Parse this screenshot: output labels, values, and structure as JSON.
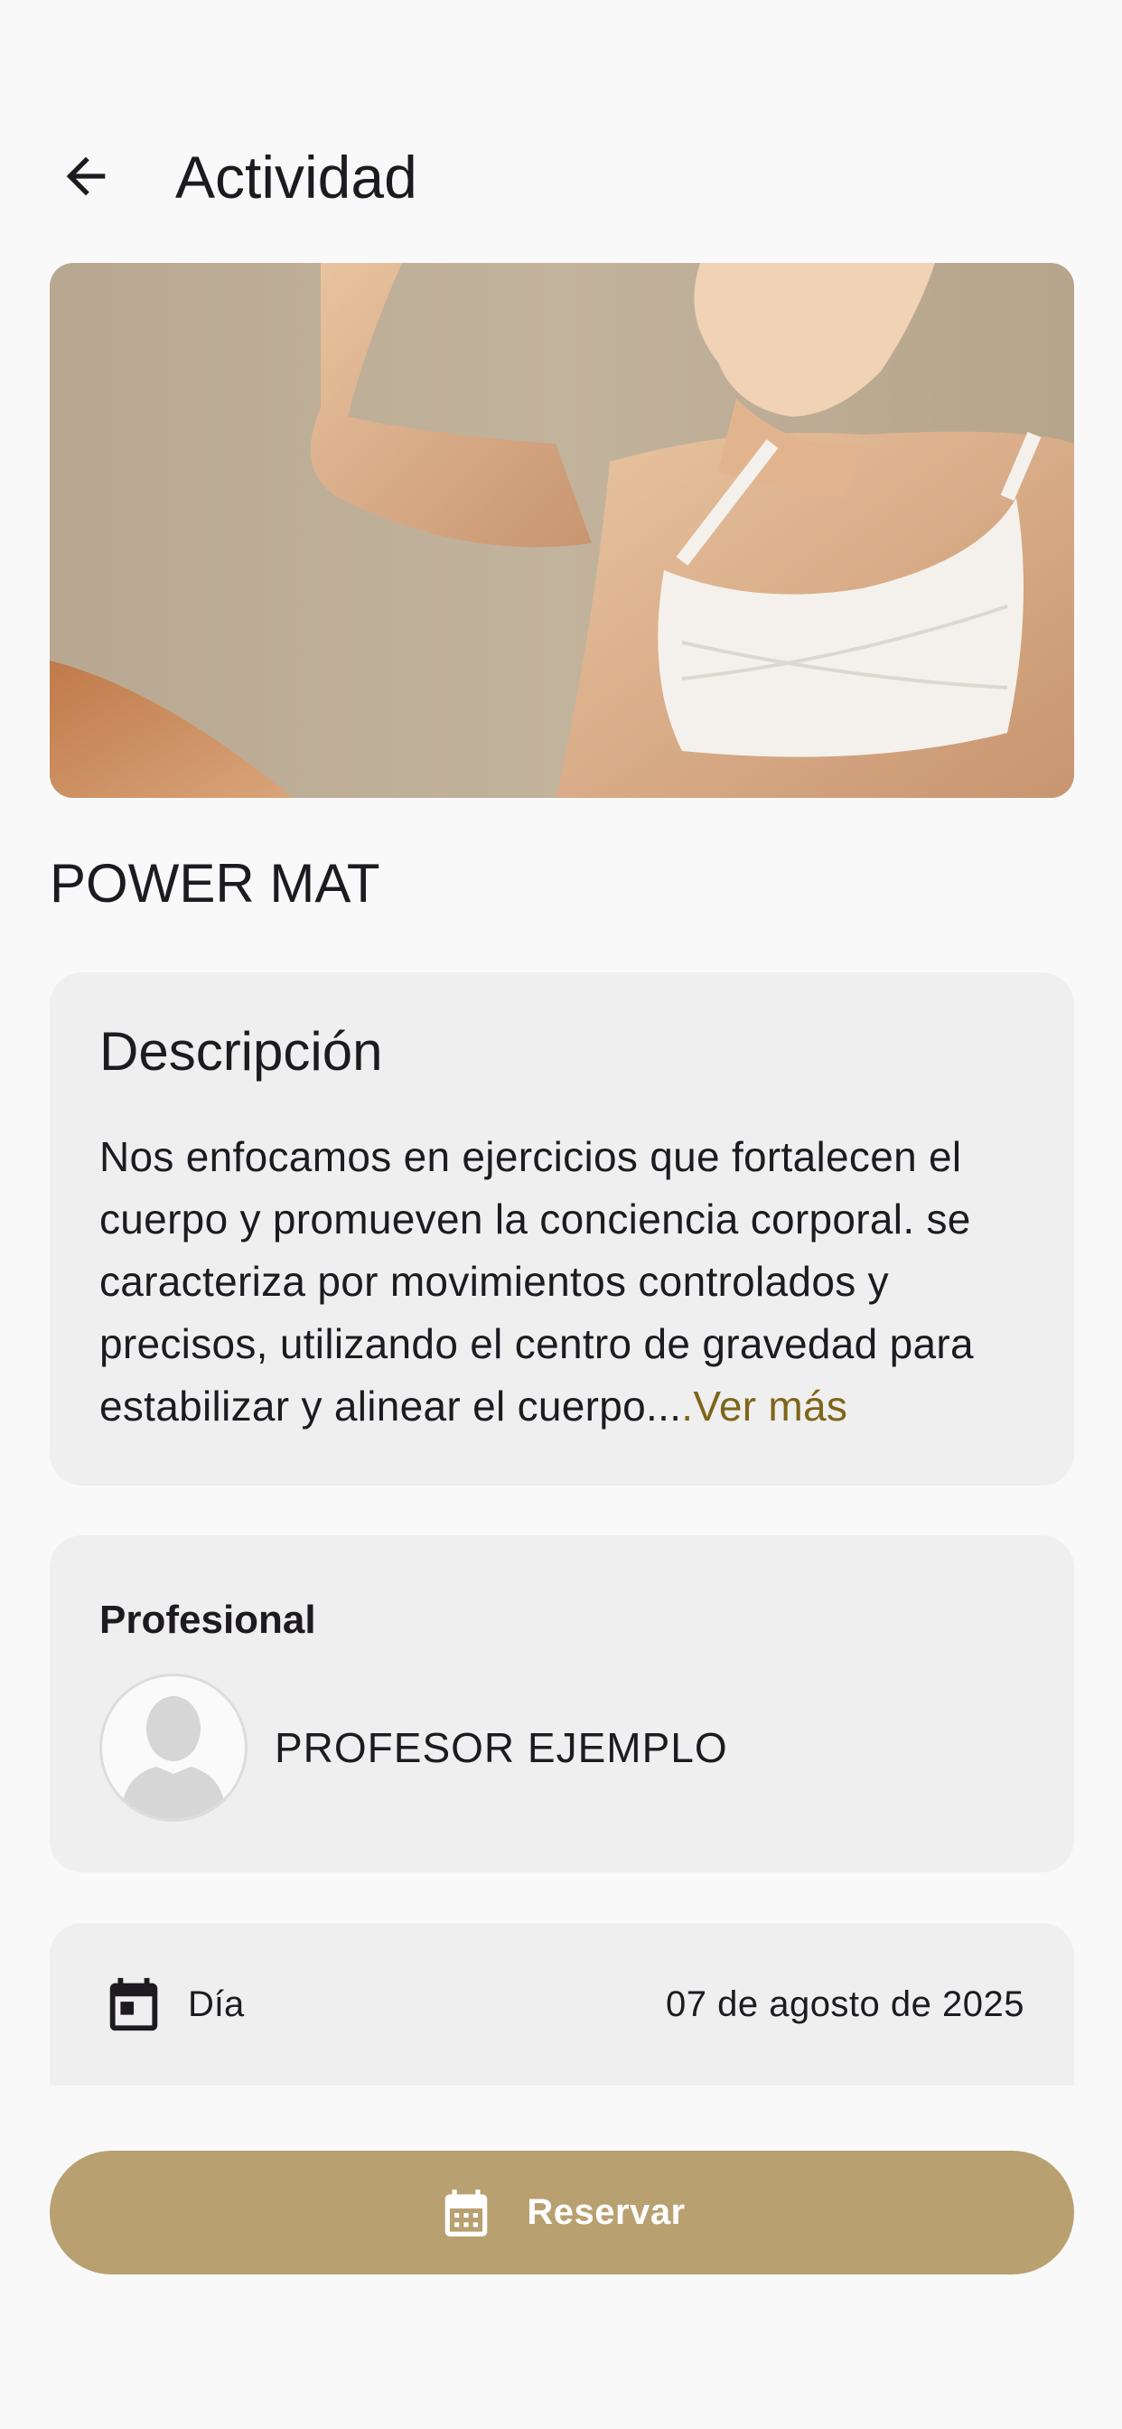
{
  "header": {
    "title": "Actividad",
    "back_icon": "arrow-back-icon"
  },
  "activity": {
    "name": "POWER MAT",
    "image_icon": "activity-photo"
  },
  "description": {
    "title": "Descripción",
    "text": "Nos enfocamos en ejercicios que fortalecen el cuerpo y promueven la conciencia corporal. se caracteriza por movimientos controlados y precisos, utilizando el centro de gravedad para estabilizar y alinear el cuerpo...",
    "see_more": ".Ver más",
    "link_color": "#7f6519"
  },
  "professional": {
    "label": "Profesional",
    "name": "PROFESOR EJEMPLO",
    "avatar_icon": "person-placeholder-icon"
  },
  "schedule": {
    "day_label": "Día",
    "day_value": "07 de agosto de 2025",
    "day_icon": "calendar-today-icon"
  },
  "actions": {
    "reserve_label": "Reservar",
    "reserve_icon": "calendar-month-icon",
    "reserve_color": "#b8a070"
  },
  "colors": {
    "background": "#f9f9f9",
    "card": "#efefef",
    "accent": "#b8a070"
  }
}
